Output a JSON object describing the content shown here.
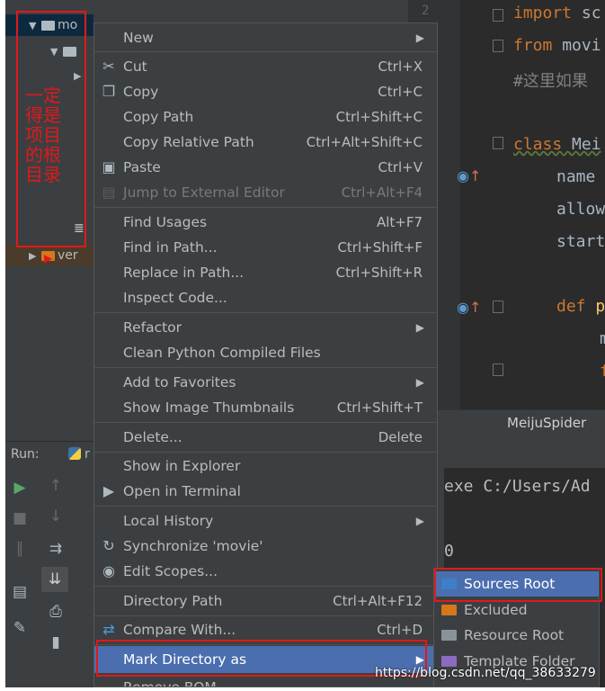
{
  "project_tree": {
    "items": [
      {
        "label": "mo",
        "expanded": true,
        "selected": true
      },
      {
        "label": "",
        "expanded": true
      },
      {
        "label": ""
      },
      {
        "label": "ver",
        "expanded": false
      }
    ],
    "annotation_text": "一定得是项目的根目录"
  },
  "editor": {
    "line_number": "2",
    "lines": [
      {
        "keyword": "import",
        "text": " sc"
      },
      {
        "keyword": "from",
        "text": " movi"
      },
      {
        "comment": "#这里如果"
      },
      {
        "keyword": "class",
        "text": " Mei"
      },
      {
        "text": "name "
      },
      {
        "text": "allow"
      },
      {
        "text": "start"
      },
      {
        "keyword": "def",
        "text": " p"
      },
      {
        "text": "m"
      },
      {
        "text": "f"
      }
    ],
    "tab_label": "MeijuSpider"
  },
  "run_panel": {
    "label": "Run:",
    "tab_label": "r",
    "console_lines": [
      "exe C:/Users/Ad",
      "0"
    ]
  },
  "context_menu": {
    "items": [
      {
        "label": "New",
        "shortcut": "",
        "submenu": true,
        "icon": ""
      },
      {
        "label": "Cut",
        "shortcut": "Ctrl+X",
        "icon": "scissors-icon"
      },
      {
        "label": "Copy",
        "shortcut": "Ctrl+C",
        "icon": "copy-icon"
      },
      {
        "label": "Copy Path",
        "shortcut": "Ctrl+Shift+C"
      },
      {
        "label": "Copy Relative Path",
        "shortcut": "Ctrl+Alt+Shift+C"
      },
      {
        "label": "Paste",
        "shortcut": "Ctrl+V",
        "icon": "paste-icon"
      },
      {
        "label": "Jump to External Editor",
        "shortcut": "Ctrl+Alt+F4",
        "icon": "external-editor-icon",
        "disabled": true
      },
      {
        "label": "Find Usages",
        "shortcut": "Alt+F7"
      },
      {
        "label": "Find in Path...",
        "shortcut": "Ctrl+Shift+F"
      },
      {
        "label": "Replace in Path...",
        "shortcut": "Ctrl+Shift+R"
      },
      {
        "label": "Inspect Code..."
      },
      {
        "label": "Refactor",
        "submenu": true
      },
      {
        "label": "Clean Python Compiled Files"
      },
      {
        "label": "Add to Favorites",
        "submenu": true
      },
      {
        "label": "Show Image Thumbnails",
        "shortcut": "Ctrl+Shift+T"
      },
      {
        "label": "Delete...",
        "shortcut": "Delete"
      },
      {
        "label": "Show in Explorer"
      },
      {
        "label": "Open in Terminal",
        "icon": "terminal-icon"
      },
      {
        "label": "Local History",
        "submenu": true
      },
      {
        "label": "Synchronize 'movie'",
        "icon": "sync-icon"
      },
      {
        "label": "Edit Scopes...",
        "icon": "scope-icon"
      },
      {
        "label": "Directory Path",
        "shortcut": "Ctrl+Alt+F12"
      },
      {
        "label": "Compare With...",
        "shortcut": "Ctrl+D",
        "icon": "compare-icon"
      },
      {
        "label": "Mark Directory as",
        "submenu": true,
        "active": true
      },
      {
        "label": "Remove BOM"
      }
    ]
  },
  "mark_submenu": {
    "items": [
      {
        "label": "Sources Root",
        "color": "#3d7fc7",
        "active": true
      },
      {
        "label": "Excluded",
        "color": "#d6771c"
      },
      {
        "label": "Resource Root",
        "color": "#8a9399"
      },
      {
        "label": "Template Folder",
        "color": "#8a6bc0"
      }
    ]
  },
  "colors": {
    "accent": "#4b6eaf",
    "annotation_red": "#e0191b"
  },
  "watermark": "https://blog.csdn.net/qq_38633279"
}
